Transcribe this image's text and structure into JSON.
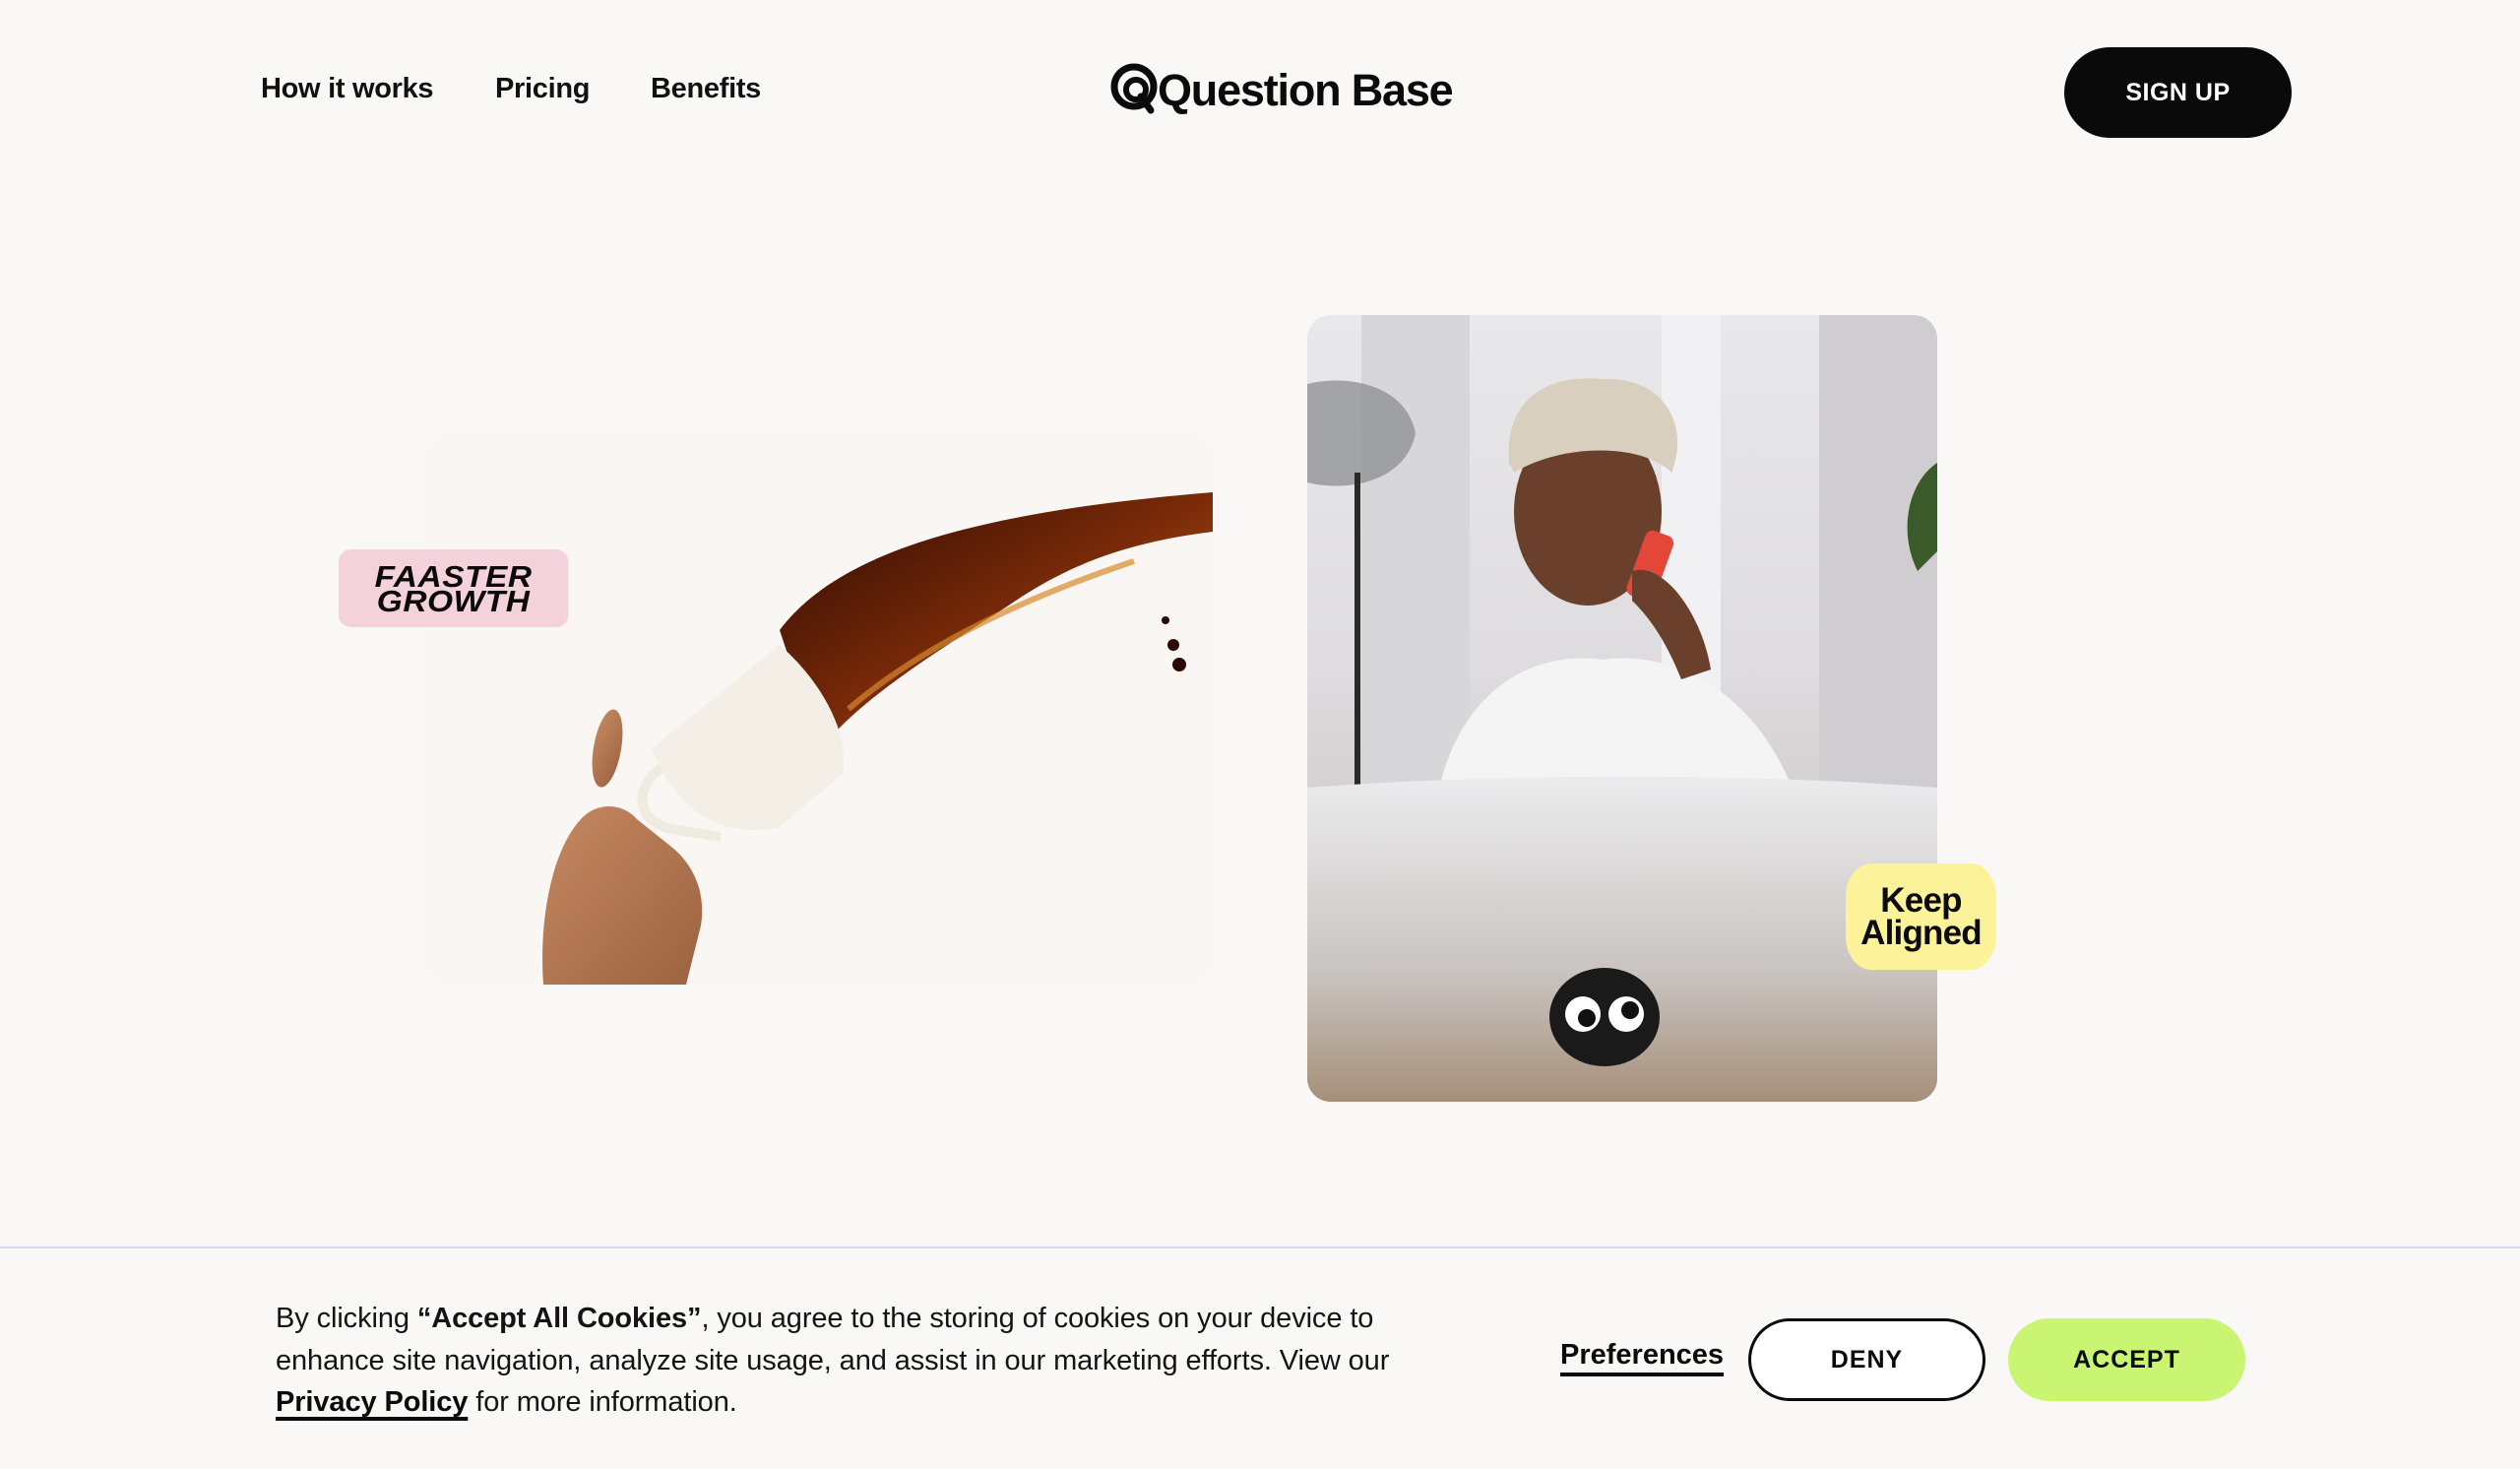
{
  "header": {
    "nav": [
      {
        "label": "How it works"
      },
      {
        "label": "Pricing"
      },
      {
        "label": "Benefits"
      }
    ],
    "logo_text": "Question Base",
    "signup_label": "SIGN UP"
  },
  "hero": {
    "badge_left": {
      "line1": "FAASTER",
      "line2": "GROWTH",
      "color": "#f4d2dc"
    },
    "badge_right": {
      "line1": "Keep",
      "line2": "Aligned",
      "color": "#fbf29a"
    },
    "image_left_subject": "hand pouring coffee from white cup",
    "image_right_subject": "man on phone behind laptop with googly eyes sticker"
  },
  "cookie_banner": {
    "text_prefix": "By clicking ",
    "text_bold": "“Accept All Cookies”",
    "text_middle": ", you agree to the storing of cookies on your device to enhance site navigation, analyze site usage, and assist in our marketing efforts. View our ",
    "privacy_link": "Privacy Policy",
    "text_suffix": " for more information.",
    "preferences_label": "Preferences",
    "deny_label": "DENY",
    "accept_label": "ACCEPT",
    "accept_color": "#c9f573"
  }
}
